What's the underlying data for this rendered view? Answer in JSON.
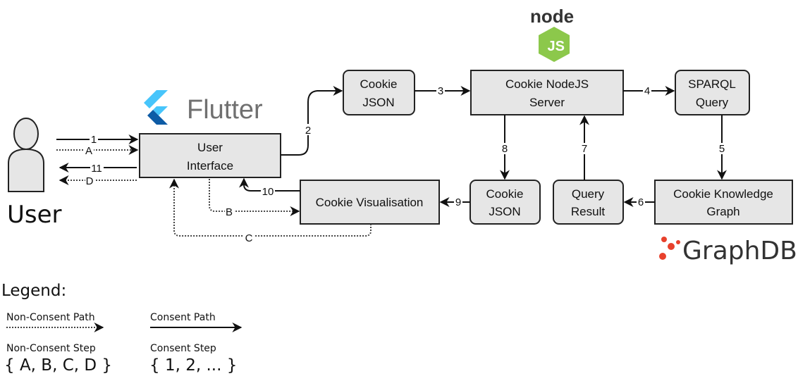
{
  "actor": {
    "label": "User"
  },
  "logos": {
    "flutter": "Flutter",
    "node": "node JS",
    "graphdb": "GraphDB"
  },
  "boxes": {
    "user_interface": [
      "User",
      "Interface"
    ],
    "cookie_json_top": [
      "Cookie",
      "JSON"
    ],
    "node_server": [
      "Cookie NodeJS",
      "Server"
    ],
    "sparql": [
      "SPARQL",
      "Query"
    ],
    "knowledge_graph": [
      "Cookie Knowledge",
      "Graph"
    ],
    "query_result": [
      "Query",
      "Result"
    ],
    "cookie_json_bottom": [
      "Cookie",
      "JSON"
    ],
    "visualisation": [
      "Cookie Visualisation"
    ]
  },
  "edges": {
    "e1": "1",
    "eA": "A",
    "e11": "11",
    "eD": "D",
    "e2": "2",
    "e3": "3",
    "e4": "4",
    "e5": "5",
    "e6": "6",
    "e7": "7",
    "e8": "8",
    "e9": "9",
    "e10": "10",
    "eB": "B",
    "eC": "C"
  },
  "legend": {
    "title": "Legend:",
    "non_consent_path": "Non-Consent Path",
    "consent_path": "Consent Path",
    "non_consent_step": "Non-Consent Step",
    "non_consent_set": "{ A, B, C, D }",
    "consent_step": "Consent Step",
    "consent_set": "{ 1, 2, ... }"
  },
  "colors": {
    "box_fill": "#e6e6e6",
    "flutter": "#47c5fb",
    "flutter_dark": "#0d5ba5",
    "node_green": "#8cc84b",
    "graphdb": "#e8412c"
  }
}
